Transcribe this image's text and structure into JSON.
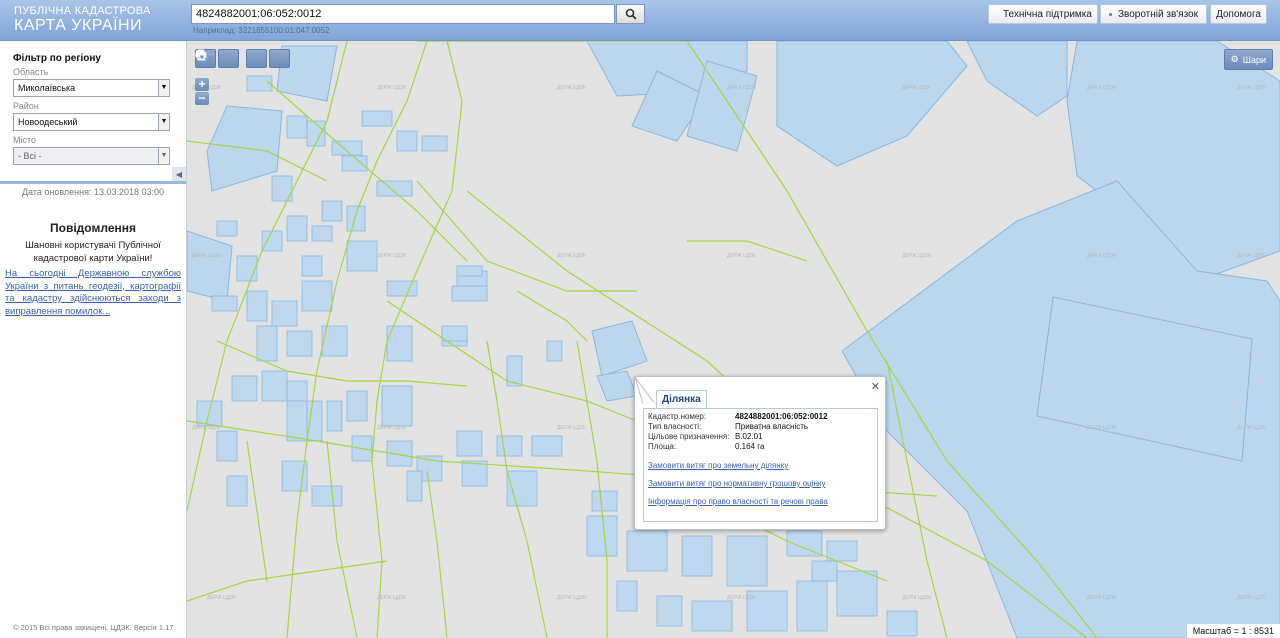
{
  "header": {
    "logo_line1": "ПУБЛІЧНА КАДАСТРОВА",
    "logo_line2": "КАРТА УКРАЇНИ",
    "search_value": "4824882001:06:052:0012",
    "search_hint": "Наприклад: 3221855100:01:047:0052",
    "buttons": {
      "support": "Технічна підтримка",
      "feedback": "Зворотній зв'язок",
      "help": "Допомога"
    }
  },
  "sidebar": {
    "filter_title": "Фільтр по регіону",
    "oblast_label": "Область",
    "oblast_value": "Миколаївська",
    "raion_label": "Район",
    "raion_value": "Новоодеський",
    "misto_label": "Місто",
    "misto_value": "- Всі -",
    "update_date": "Дата оновлення: 13.03.2018 03:00",
    "notice_title": "Повідомлення",
    "notice_text": "Шановні користувачі Публічної кадастрової карти України!",
    "notice_link": "На сьогодні Державною службою України з питань геодезії, картографії та кадастру здійснюються заходи з виправлення помилок...",
    "copyright": "© 2015 Всі права захищені. ЦДЗК. Версія 1.17"
  },
  "map": {
    "layers_label": "Шари",
    "scale_label": "Масштаб = 1 : 8531",
    "popup": {
      "tab": "Ділянка",
      "rows": [
        {
          "key": "Кадастр.номер:",
          "value": "4824882001:06:052:0012"
        },
        {
          "key": "Тип власності:",
          "value": "Приватна власність"
        },
        {
          "key": "Цільове призначення:",
          "value": "В.02.01"
        },
        {
          "key": "Площа:",
          "value": "0.164 га"
        }
      ],
      "links": [
        "Замовити витяг про земельну ділянку",
        "Замовити витяг про нормативну грошову оцінку",
        "Інформація про право власності та речові права"
      ]
    }
  },
  "colors": {
    "header_bg": "#8fb0de",
    "parcel_fill": "#bcd6ec",
    "parcel_stroke": "#8ab8df",
    "boundary_line": "#a6d44a",
    "map_bg": "#e2e2e2"
  }
}
